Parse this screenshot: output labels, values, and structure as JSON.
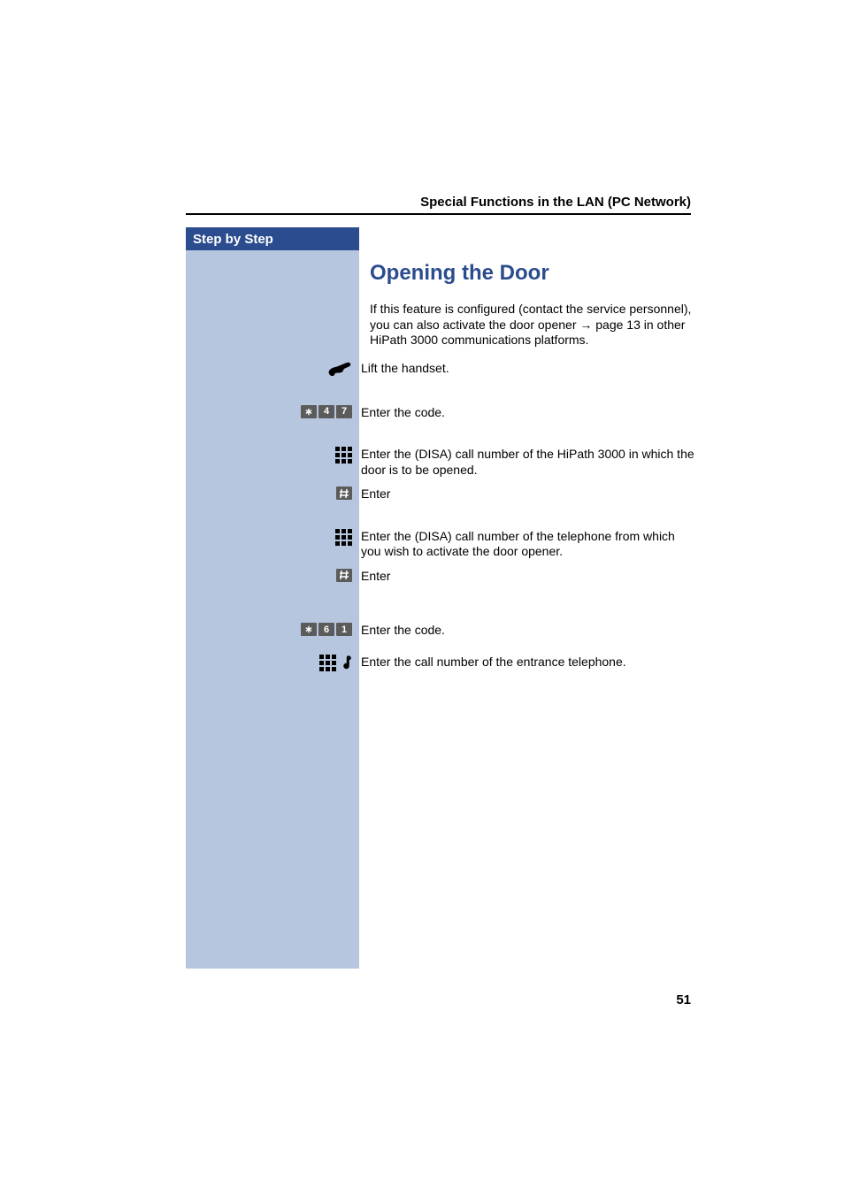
{
  "header": {
    "title": "Special Functions in the LAN (PC Network)"
  },
  "sidebar": {
    "label": "Step by Step"
  },
  "section": {
    "heading": "Opening the Door",
    "intro": "If this feature is configured (contact the service personnel), you can also activate the door opener → page 13 in other HiPath 3000 communications platforms."
  },
  "steps": [
    {
      "icon": "handset",
      "text": "Lift the handset."
    },
    {
      "icon": "keyseq",
      "keys": [
        "∗",
        "4",
        "7"
      ],
      "text": "Enter the code."
    },
    {
      "icon": "keypad",
      "text": "Enter the (DISA) call number of the HiPath 3000 in which the door is to be opened."
    },
    {
      "icon": "hash",
      "text": "Enter"
    },
    {
      "icon": "keypad",
      "text": "Enter the (DISA) call number of the telephone from which you wish to activate the door opener."
    },
    {
      "icon": "hash",
      "text": "Enter"
    },
    {
      "icon": "keyseq",
      "keys": [
        "∗",
        "6",
        "1"
      ],
      "text": "Enter the code."
    },
    {
      "icon": "keypad-note",
      "text": "Enter the call number of the entrance telephone."
    }
  ],
  "page_number": "51"
}
